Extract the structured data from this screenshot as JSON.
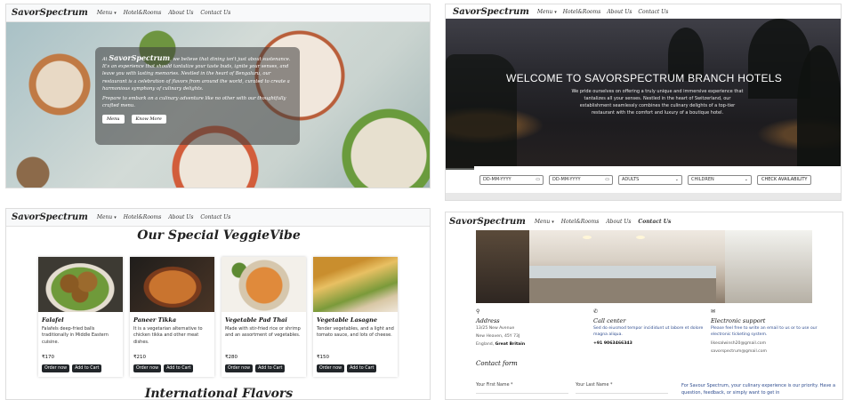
{
  "nav": {
    "brand": "SavorSpectrum",
    "menu": "Menu",
    "hotels": "Hotel&Rooms",
    "about": "About Us",
    "contact": "Contact Us"
  },
  "home": {
    "intro": "At",
    "brand_word": "SavorSpectrum",
    "paragraph": ", we believe that dining isn't just about sustenance. It's an experience that should tantalize your taste buds, ignite your senses, and leave you with lasting memories. Nestled in the heart of Bengaluru, our restaurant is a celebration of flavors from around the world, curated to create a harmonious symphony of culinary delights.",
    "paragraph2": "Prepare to embark on a culinary adventure like no other with our thoughtfully crafted menu.",
    "btn_menu": "Menu",
    "btn_know_more": "Know More"
  },
  "hotels": {
    "title": "WELCOME TO SAVORSPECTRUM BRANCH HOTELS",
    "subtitle": "We pride ourselves on offering a truly unique and immersive experience that tantalizes all your senses. Nestled in the heart of Switzerland, our establishment seamlessly combines the culinary delights of a top-tier restaurant with the comfort and luxury of a boutique hotel.",
    "checkin_placeholder": "DD-MM-YYYY",
    "checkout_placeholder": "DD-MM-YYYY",
    "adults": "ADULTS",
    "children": "CHILDREN",
    "check_btn": "CHECK AVAILABILITY"
  },
  "menu_page": {
    "title": "Our Special VeggieVibe",
    "order_label": "Order now",
    "cart_label": "Add to Cart",
    "next_section": "International Flavors",
    "cards": [
      {
        "name": "Falafel",
        "desc": "Falafels deep-fried balls traditionally in Middle Eastern cuisine.",
        "price": "₹170"
      },
      {
        "name": "Paneer Tikka",
        "desc": "It is a vegetarian alternative to chicken tikka and other meat dishes.",
        "price": "₹210"
      },
      {
        "name": "Vegetable Pad Thai",
        "desc": "Made with stir-fried rice or shrimp and an assortment of vegetables.",
        "price": "₹280"
      },
      {
        "name": "Vegetable Lasagne",
        "desc": "Tender vegetables, and a light and tomato sauce, and lots of cheese.",
        "price": "₹150"
      }
    ]
  },
  "contact": {
    "address_head": "Address",
    "address_text": "13/25 New Avenue",
    "address_text2": "New Heaven, 45Y 73J",
    "address_text3": "England,",
    "address_bold": "Great Britain",
    "call_head": "Call center",
    "call_text": "Sed do eiusmod tempor incididunt ut labore et dolore magna aliqua.",
    "call_number": "+91 9063466343",
    "support_head": "Electronic support",
    "support_text": "Please feel free to write an email to us or to use our electronic ticketing system.",
    "support_email1": "likesalwinsh20@gmail.com",
    "support_email2": "savorspectrum@gmail.com",
    "form_title": "Contact form",
    "first_name": "Your First Name *",
    "last_name": "Your Last Name *",
    "message": "For Savour Spectrum, your culinary experience is our priority. Have a question, feedback, or simply want to get in"
  }
}
